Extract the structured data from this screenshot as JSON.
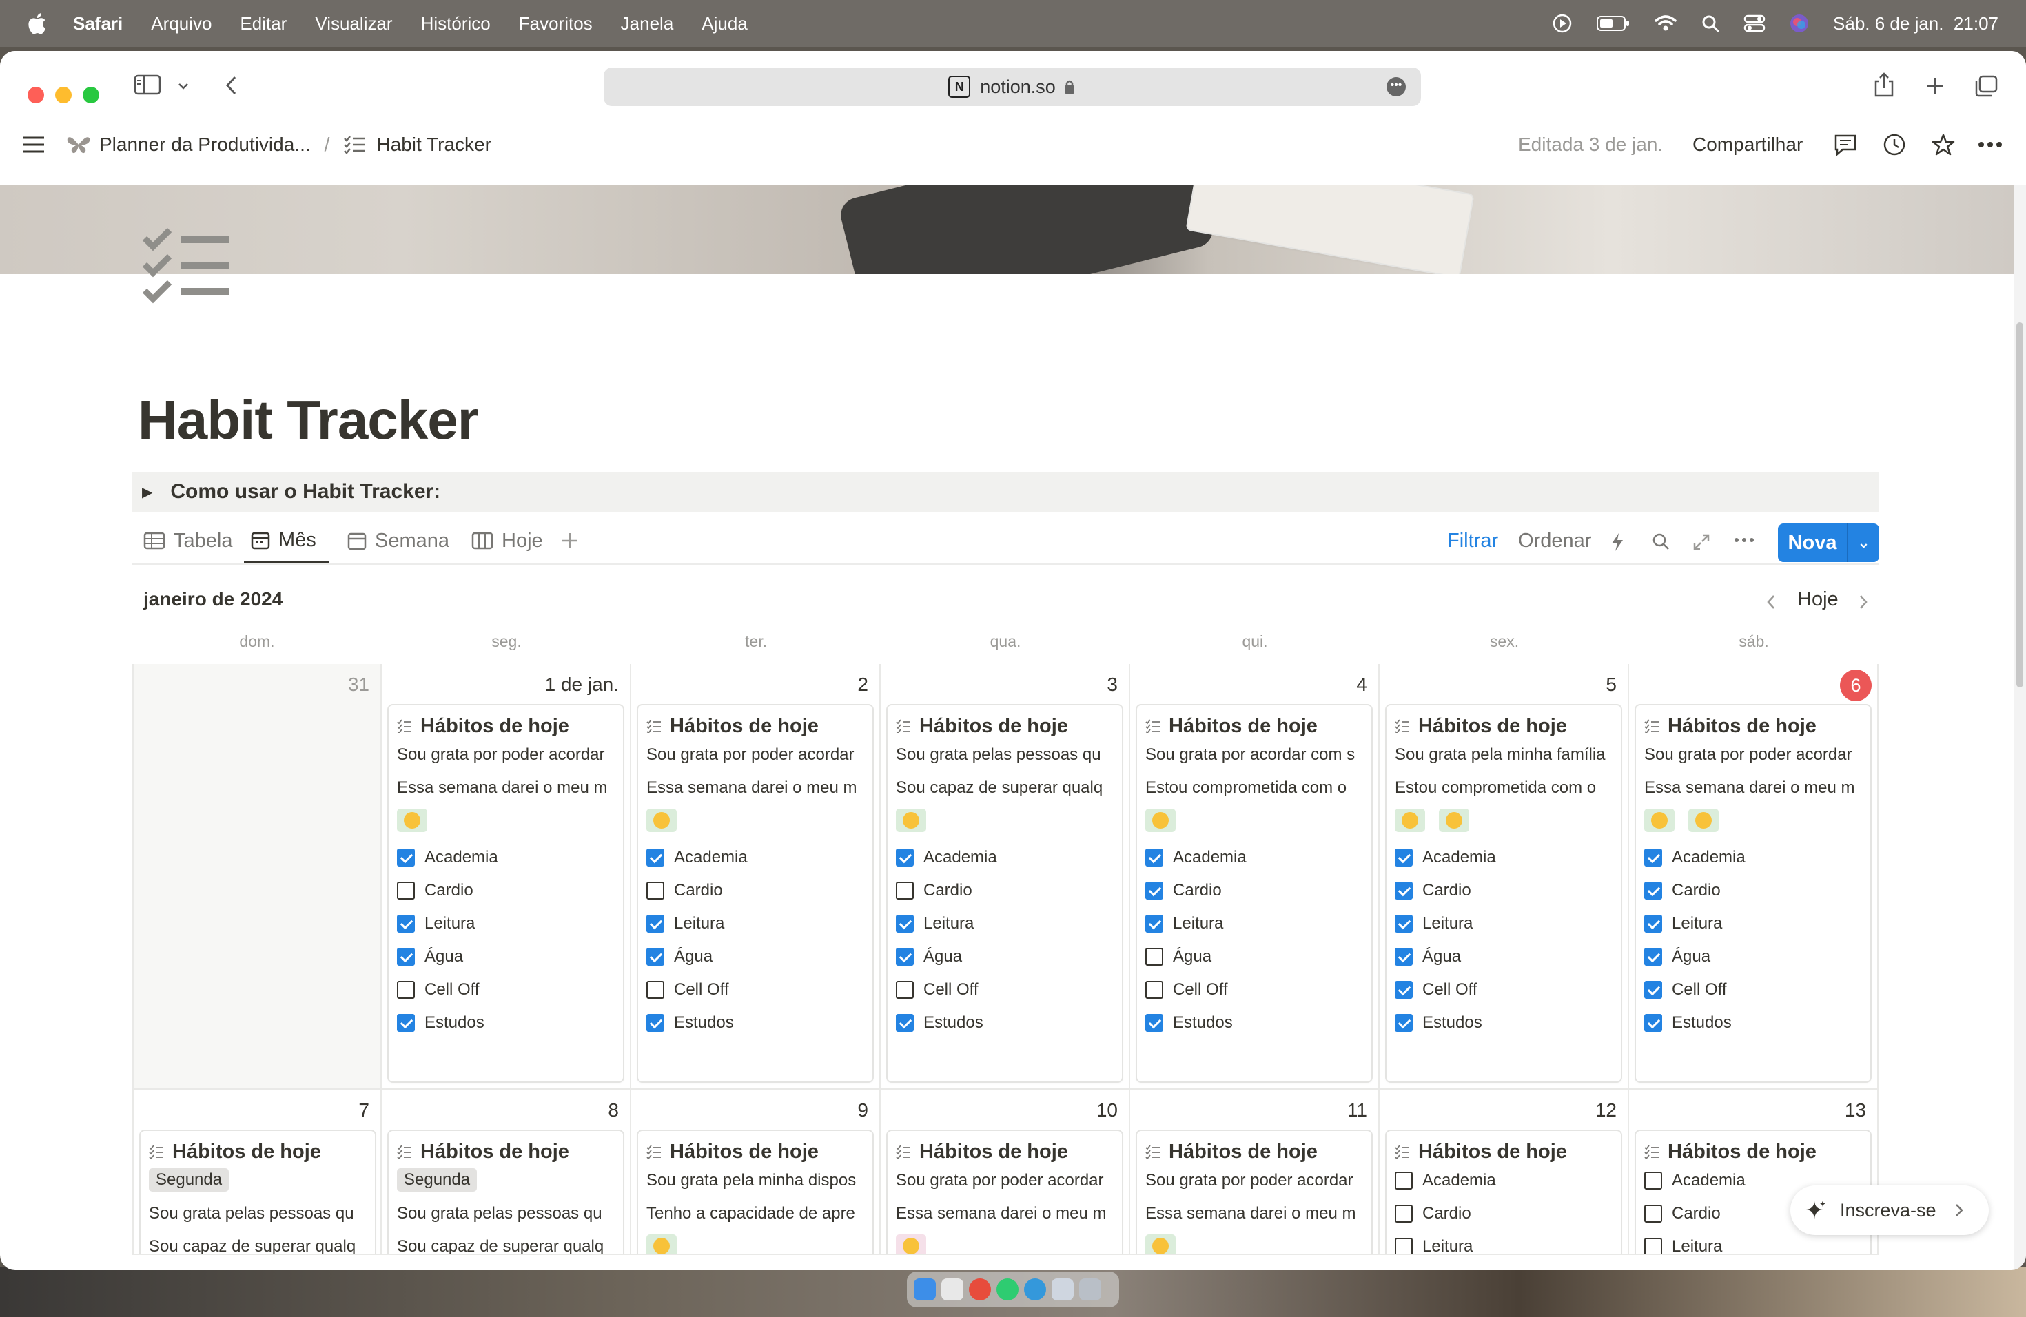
{
  "menubar": {
    "app": "Safari",
    "items": [
      "Arquivo",
      "Editar",
      "Visualizar",
      "Histórico",
      "Favoritos",
      "Janela",
      "Ajuda"
    ],
    "datetime": "Sáb. 6 de jan.  21:07"
  },
  "browser": {
    "url": "notion.so",
    "favicon_letter": "N"
  },
  "topbar": {
    "breadcrumb_parent": "Planner da Produtivida...",
    "breadcrumb_sep": "/",
    "breadcrumb_current": "Habit Tracker",
    "edited": "Editada 3 de jan.",
    "share": "Compartilhar"
  },
  "page": {
    "title": "Habit Tracker",
    "toggle": "Como usar o Habit Tracker:"
  },
  "views": {
    "tabs": [
      "Tabela",
      "Mês",
      "Semana",
      "Hoje"
    ],
    "active": "Mês",
    "filter": "Filtrar",
    "sort": "Ordenar",
    "new": "Nova"
  },
  "calendar": {
    "month_label": "janeiro de 2024",
    "today_button": "Hoje",
    "weekdays": [
      "dom.",
      "seg.",
      "ter.",
      "qua.",
      "qui.",
      "sex.",
      "sáb."
    ],
    "week1": [
      {
        "day": "31"
      },
      {
        "day": "1 de jan.",
        "card": {
          "title": "Hábitos de hoje",
          "lines": [
            "Sou grata por poder acordar",
            "Essa semana darei o meu m"
          ],
          "emojis": [
            "green"
          ],
          "habits": [
            [
              "Academia",
              true
            ],
            [
              "Cardio",
              false
            ],
            [
              "Leitura",
              true
            ],
            [
              "Água",
              true
            ],
            [
              "Cell Off",
              false
            ],
            [
              "Estudos",
              true
            ]
          ]
        }
      },
      {
        "day": "2",
        "card": {
          "title": "Hábitos de hoje",
          "lines": [
            "Sou grata por poder acordar",
            "Essa semana darei o meu m"
          ],
          "emojis": [
            "green"
          ],
          "habits": [
            [
              "Academia",
              true
            ],
            [
              "Cardio",
              false
            ],
            [
              "Leitura",
              true
            ],
            [
              "Água",
              true
            ],
            [
              "Cell Off",
              false
            ],
            [
              "Estudos",
              true
            ]
          ]
        }
      },
      {
        "day": "3",
        "card": {
          "title": "Hábitos de hoje",
          "lines": [
            "Sou grata pelas pessoas qu",
            "Sou capaz de superar qualq"
          ],
          "emojis": [
            "green"
          ],
          "habits": [
            [
              "Academia",
              true
            ],
            [
              "Cardio",
              false
            ],
            [
              "Leitura",
              true
            ],
            [
              "Água",
              true
            ],
            [
              "Cell Off",
              false
            ],
            [
              "Estudos",
              true
            ]
          ]
        }
      },
      {
        "day": "4",
        "card": {
          "title": "Hábitos de hoje",
          "lines": [
            "Sou grata por acordar com s",
            "Estou comprometida com o"
          ],
          "emojis": [
            "green"
          ],
          "habits": [
            [
              "Academia",
              true
            ],
            [
              "Cardio",
              true
            ],
            [
              "Leitura",
              true
            ],
            [
              "Água",
              false
            ],
            [
              "Cell Off",
              false
            ],
            [
              "Estudos",
              true
            ]
          ]
        }
      },
      {
        "day": "5",
        "card": {
          "title": "Hábitos de hoje",
          "lines": [
            "Sou grata pela minha família",
            "Estou comprometida com o"
          ],
          "emojis": [
            "green",
            "green"
          ],
          "habits": [
            [
              "Academia",
              true
            ],
            [
              "Cardio",
              true
            ],
            [
              "Leitura",
              true
            ],
            [
              "Água",
              true
            ],
            [
              "Cell Off",
              true
            ],
            [
              "Estudos",
              true
            ]
          ]
        }
      },
      {
        "day": "6",
        "today": true,
        "card": {
          "title": "Hábitos de hoje",
          "lines": [
            "Sou grata por poder acordar",
            "Essa semana darei o meu m"
          ],
          "emojis": [
            "green",
            "green"
          ],
          "habits": [
            [
              "Academia",
              true
            ],
            [
              "Cardio",
              true
            ],
            [
              "Leitura",
              true
            ],
            [
              "Água",
              true
            ],
            [
              "Cell Off",
              true
            ],
            [
              "Estudos",
              true
            ]
          ]
        }
      }
    ],
    "week2": [
      {
        "day": "7",
        "card": {
          "title": "Hábitos de hoje",
          "tag": "Segunda",
          "lines": [
            "Sou grata pelas pessoas qu",
            "Sou capaz de superar qualq"
          ]
        }
      },
      {
        "day": "8",
        "card": {
          "title": "Hábitos de hoje",
          "tag": "Segunda",
          "lines": [
            "Sou grata pelas pessoas qu",
            "Sou capaz de superar qualq"
          ]
        }
      },
      {
        "day": "9",
        "card": {
          "title": "Hábitos de hoje",
          "lines": [
            "Sou grata pela minha dispos",
            "Tenho a capacidade de apre"
          ],
          "emojis": [
            "green"
          ]
        }
      },
      {
        "day": "10",
        "card": {
          "title": "Hábitos de hoje",
          "lines": [
            "Sou grata por poder acordar",
            "Essa semana darei o meu m"
          ],
          "emojis": [
            "pink"
          ]
        }
      },
      {
        "day": "11",
        "card": {
          "title": "Hábitos de hoje",
          "lines": [
            "Sou grata por poder acordar",
            "Essa semana darei o meu m"
          ],
          "emojis": [
            "green"
          ]
        }
      },
      {
        "day": "12",
        "card": {
          "title": "Hábitos de hoje",
          "habits": [
            [
              "Academia",
              false
            ],
            [
              "Cardio",
              false
            ],
            [
              "Leitura",
              false
            ]
          ]
        }
      },
      {
        "day": "13",
        "card": {
          "title": "Hábitos de hoje",
          "habits": [
            [
              "Academia",
              false
            ],
            [
              "Cardio",
              false
            ],
            [
              "Leitura",
              false
            ]
          ]
        }
      }
    ]
  },
  "subscribe": "Inscreva-se"
}
